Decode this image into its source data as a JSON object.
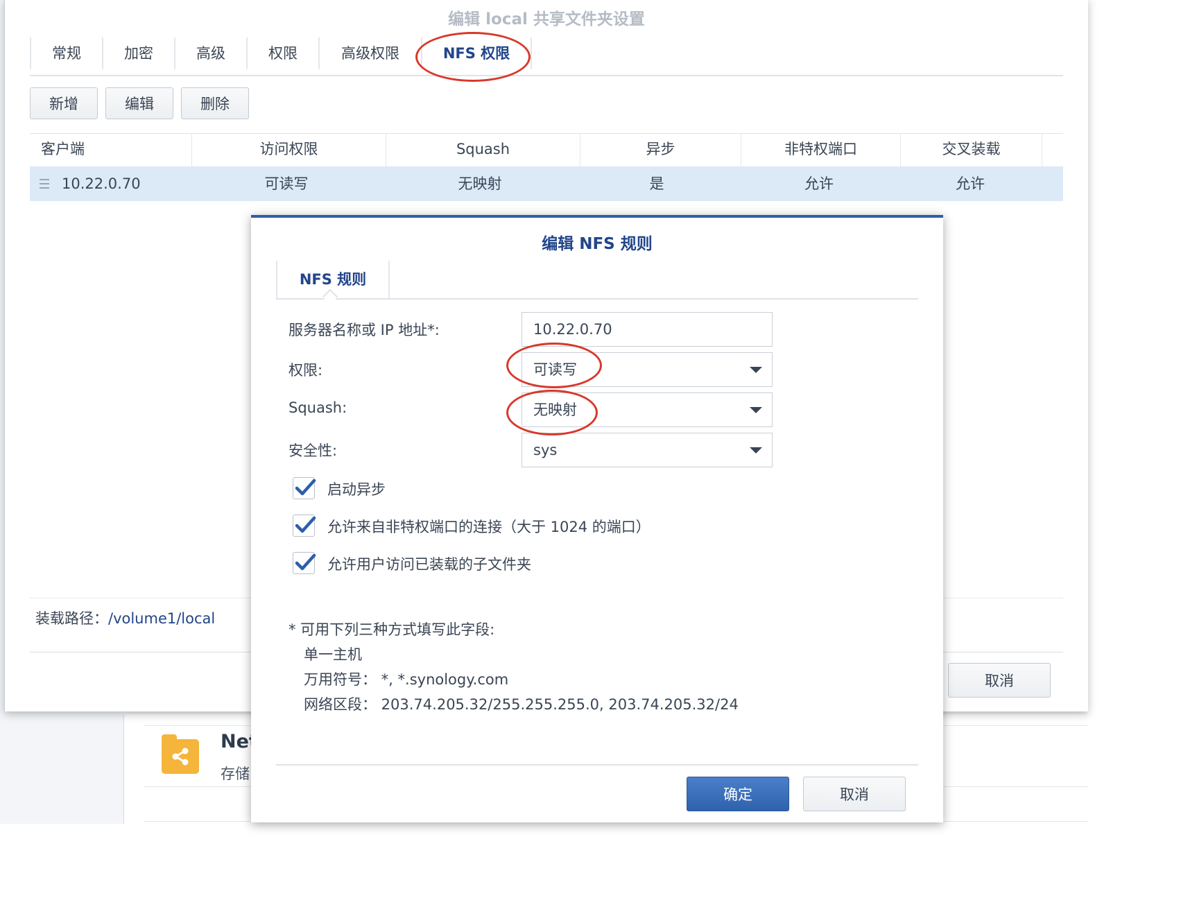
{
  "background": {
    "item_name": "Net",
    "item_sub": "存储",
    "icon": "share-folder-icon"
  },
  "window": {
    "title": "编辑 local 共享文件夹设置",
    "tabs": [
      {
        "label": "常规"
      },
      {
        "label": "加密"
      },
      {
        "label": "高级"
      },
      {
        "label": "权限"
      },
      {
        "label": "高级权限"
      },
      {
        "label": "NFS 权限",
        "active": true
      }
    ],
    "toolbar": {
      "add": "新增",
      "edit": "编辑",
      "delete": "删除"
    },
    "columns": [
      "客户端",
      "访问权限",
      "Squash",
      "异步",
      "非特权端口",
      "交叉装载"
    ],
    "rows": [
      {
        "client": "10.22.0.70",
        "access": "可读写",
        "squash": "无映射",
        "async": "是",
        "nonpriv": "允许",
        "crossmnt": "允许"
      }
    ],
    "mount_label": "装载路径：",
    "mount_path": "/volume1/local",
    "cancel": "取消"
  },
  "dialog": {
    "title": "编辑 NFS 规则",
    "tab": "NFS 规则",
    "server_label": "服务器名称或 IP 地址*:",
    "server_value": "10.22.0.70",
    "privilege_label": "权限:",
    "privilege_value": "可读写",
    "squash_label": "Squash:",
    "squash_value": "无映射",
    "security_label": "安全性:",
    "security_value": "sys",
    "checkboxes": [
      {
        "label": "启动异步",
        "checked": true
      },
      {
        "label": "允许来自非特权端口的连接（大于 1024 的端口）",
        "checked": true
      },
      {
        "label": "允许用户访问已装载的子文件夹",
        "checked": true
      }
    ],
    "note": {
      "heading": "* 可用下列三种方式填写此字段:",
      "single": "单一主机",
      "wildcard": "万用符号：  *, *.synology.com",
      "network": "网络区段：  203.74.205.32/255.255.255.0, 203.74.205.32/24"
    },
    "ok": "确定",
    "cancel": "取消"
  },
  "colors": {
    "accent": "#2d5ea9",
    "selected_row": "#dce9f7",
    "highlight_circle": "#d8382a"
  }
}
